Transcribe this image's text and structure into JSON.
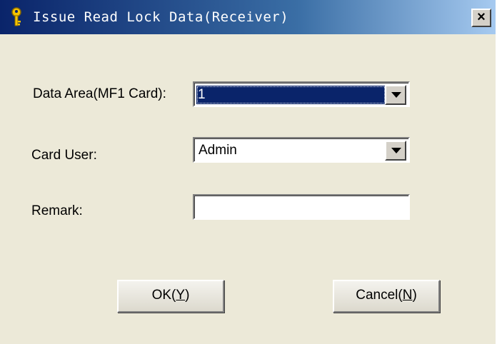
{
  "window": {
    "title": "Issue Read Lock Data(Receiver)",
    "title_icon": "key-icon",
    "close_label": "×",
    "colors": {
      "titlebar_start": "#0a246a",
      "titlebar_end": "#a6caf0",
      "background": "#ece9d8",
      "selection": "#0a246a"
    }
  },
  "form": {
    "data_area": {
      "label": "Data Area(MF1 Card):",
      "value": "1"
    },
    "card_user": {
      "label": "Card User:",
      "value": "Admin"
    },
    "remark": {
      "label": "Remark:",
      "value": ""
    }
  },
  "buttons": {
    "ok": {
      "label_prefix": "OK(",
      "mnemonic": "Y",
      "label_suffix": ")"
    },
    "cancel": {
      "label_prefix": "Cancel(",
      "mnemonic": "N",
      "label_suffix": ")"
    }
  }
}
